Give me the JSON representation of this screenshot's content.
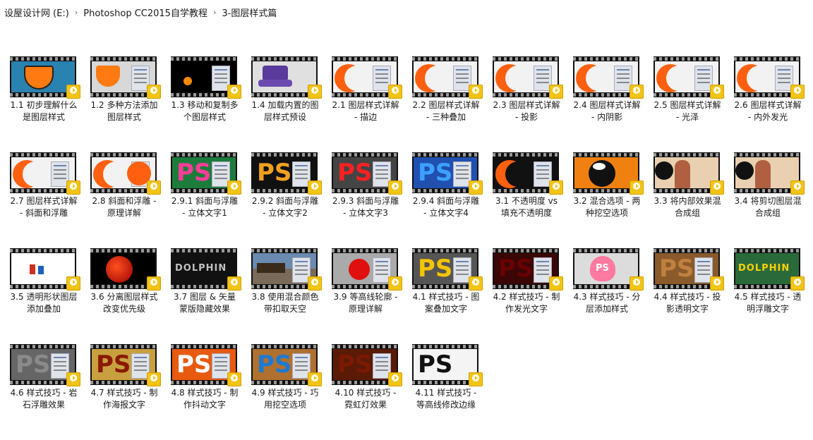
{
  "breadcrumb": {
    "items": [
      "设屋设计网 (E:)",
      "Photoshop CC2015自学教程",
      "3-图层样式篇"
    ],
    "separator": "›"
  },
  "play_badge_icon": "play-circle-icon",
  "files": [
    {
      "label": "1.1 初步理解什么是图层样式",
      "art": "shield",
      "bg": "#2a82b0"
    },
    {
      "label": "1.2 多种方法添加图层样式",
      "art": "shield2",
      "bg": "#d8d8d8"
    },
    {
      "label": "1.3 移动和复制多个图层样式",
      "art": "dots",
      "bg": "#000000"
    },
    {
      "label": "1.4 加载内置的图层样式预设",
      "art": "gamecube",
      "bg": "#e0e0e0"
    },
    {
      "label": "2.1 图层样式详解 - 描边",
      "art": "moon",
      "bg": "#f2f2f2"
    },
    {
      "label": "2.2 图层样式详解 - 三种叠加",
      "art": "moon",
      "bg": "#f2f2f2"
    },
    {
      "label": "2.3 图层样式详解 - 投影",
      "art": "moon",
      "bg": "#f2f2f2"
    },
    {
      "label": "2.4 图层样式详解 - 内阴影",
      "art": "moon",
      "bg": "#f2f2f2"
    },
    {
      "label": "2.5 图层样式详解 - 光泽",
      "art": "moon",
      "bg": "#f2f2f2"
    },
    {
      "label": "2.6 图层样式详解 - 内外发光",
      "art": "moon",
      "bg": "#f2f2f2"
    },
    {
      "label": "2.7 图层样式详解 - 斜面和浮雕",
      "art": "moon",
      "bg": "#f2f2f2"
    },
    {
      "label": "2.8 斜面和浮雕 - 原理详解",
      "art": "moon2",
      "bg": "#f2f2f2"
    },
    {
      "label": "2.9.1 斜面与浮雕 - 立体文字1",
      "art": "ps",
      "bg": "#1c7c3c",
      "psColor": "#ff3d9a"
    },
    {
      "label": "2.9.2 斜面与浮雕 - 立体文字2",
      "art": "ps",
      "bg": "#111111",
      "psColor": "#f0a020"
    },
    {
      "label": "2.9.3 斜面与浮雕 - 立体文字3",
      "art": "ps",
      "bg": "#444444",
      "psColor": "#ff2020"
    },
    {
      "label": "2.9.4 斜面与浮雕 - 立体文字4",
      "art": "ps",
      "bg": "#2050b0",
      "psColor": "#3ca0ff"
    },
    {
      "label": "3.1 不透明度 vs 填充不透明度",
      "art": "moon",
      "bg": "#111111"
    },
    {
      "label": "3.2 混合选项 - 两种挖空选项",
      "art": "bubble",
      "bg": "#f08010"
    },
    {
      "label": "3.3 将内部效果混合成组",
      "art": "photo",
      "bg": "#e8d0b0"
    },
    {
      "label": "3.4 将剪切图层混合成组",
      "art": "photo",
      "bg": "#e8d0b0"
    },
    {
      "label": "3.5 透明形状图层添加叠加",
      "art": "figures",
      "bg": "#ffffff"
    },
    {
      "label": "3.6 分离图层样式改变优先级",
      "art": "ball",
      "bg": "#000000"
    },
    {
      "label": "3.7 图层 & 矢量蒙版隐藏效果",
      "art": "text",
      "bg": "#111111",
      "text": "DOLPHIN",
      "textColor": "#c0c0c0"
    },
    {
      "label": "3.8 使用混合颜色带扣取天空",
      "art": "house",
      "bg": "#6a8ab0"
    },
    {
      "label": "3.9 等高线轮廓 - 原理详解",
      "art": "redball",
      "bg": "#aaaaaa"
    },
    {
      "label": "4.1 样式技巧 - 图案叠加文字",
      "art": "ps",
      "bg": "#555555",
      "psColor": "#f5c400"
    },
    {
      "label": "4.2 样式技巧 - 制作发光文字",
      "art": "ps",
      "bg": "#3a0606",
      "psColor": "#6a0000"
    },
    {
      "label": "4.3 样式技巧 - 分层添加样式",
      "art": "heart",
      "bg": "#dcdcdc"
    },
    {
      "label": "4.4 样式技巧 - 投影透明文字",
      "art": "ps",
      "bg": "#8a5a2a",
      "psColor": "#c08040"
    },
    {
      "label": "4.5 样式技巧 - 透明浮雕文字",
      "art": "text",
      "bg": "#2a6a3a",
      "text": "DOLPHIN",
      "textColor": "#ffd000"
    },
    {
      "label": "4.6 样式技巧 - 岩石浮雕效果",
      "art": "ps",
      "bg": "#666666",
      "psColor": "#8a8a8a"
    },
    {
      "label": "4.7 样式技巧 - 制作海报文字",
      "art": "ps",
      "bg": "#c8a040",
      "psColor": "#8a1a00"
    },
    {
      "label": "4.8 样式技巧 - 制作抖动文字",
      "art": "ps",
      "bg": "#e85a10",
      "psColor": "#ffffff"
    },
    {
      "label": "4.9 样式技巧 - 巧用挖空选项",
      "art": "ps",
      "bg": "#b07030",
      "psColor": "#1e7ad0"
    },
    {
      "label": "4.10 样式技巧 - 霓虹灯效果",
      "art": "ps",
      "bg": "#5a1a06",
      "psColor": "#7a1a00"
    },
    {
      "label": "4.11 样式技巧 - 等高线修改边缘",
      "art": "ps",
      "bg": "#f4f4f4",
      "psColor": "#111111"
    }
  ]
}
